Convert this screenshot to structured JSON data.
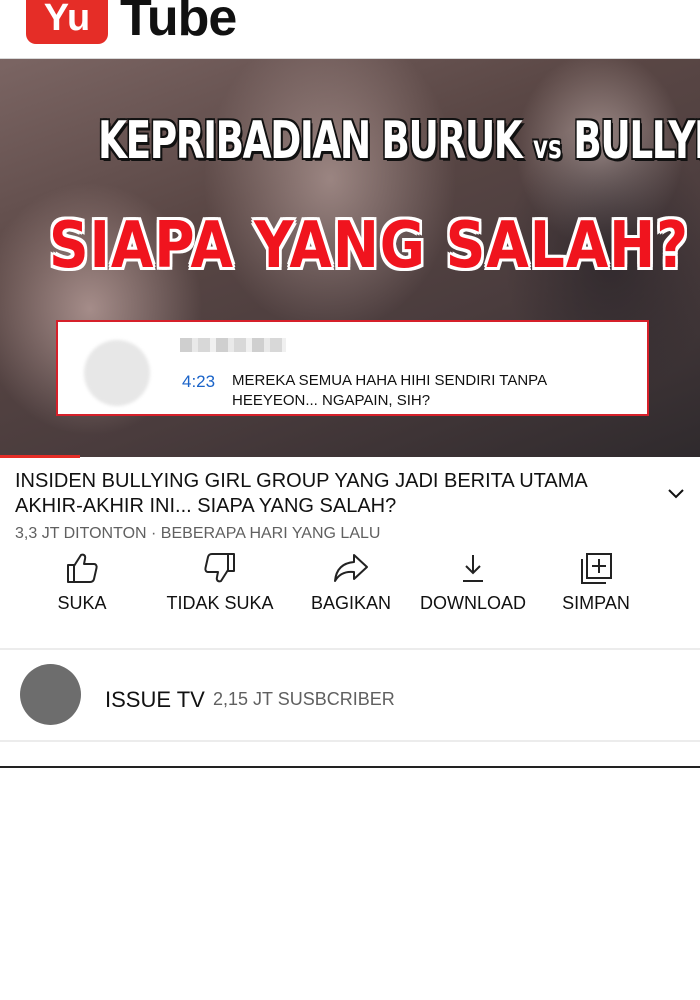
{
  "header": {
    "logo_box_text": "Yu",
    "logo_rest_text": "Tube"
  },
  "thumbnail": {
    "title_line1_a": "KEPRIBADIAN BURUK ",
    "title_line1_vs": "vs",
    "title_line1_b": " BULLYING",
    "title_line2": "SIAPA YANG SALAH?",
    "comment": {
      "time": "4:23",
      "text": "MEREKA SEMUA HAHA HIHI SENDIRI TANPA HEEYEON... NGAPAIN, SIH?"
    },
    "progress": 0.114
  },
  "video": {
    "title": "INSIDEN BULLYING GIRL GROUP YANG JADI BERITA UTAMA AKHIR-AKHIR INI... SIAPA YANG SALAH?",
    "meta": "3,3 JT DITONTON · BEBERAPA HARI YANG LALU"
  },
  "actions": [
    {
      "label": "SUKA",
      "icon": "thumbs-up-icon"
    },
    {
      "label": "TIDAK SUKA",
      "icon": "thumbs-down-icon"
    },
    {
      "label": "BAGIKAN",
      "icon": "share-icon"
    },
    {
      "label": "DOWNLOAD",
      "icon": "download-icon"
    },
    {
      "label": "SIMPAN",
      "icon": "add-to-playlist-icon"
    }
  ],
  "channel": {
    "name": "ISSUE TV",
    "subscribers": "2,15 JT SUSBCRIBER"
  },
  "colors": {
    "brand": "#e52d27",
    "comment_time": "#1a63c8",
    "thumbnail_title2": "#f0141e"
  }
}
